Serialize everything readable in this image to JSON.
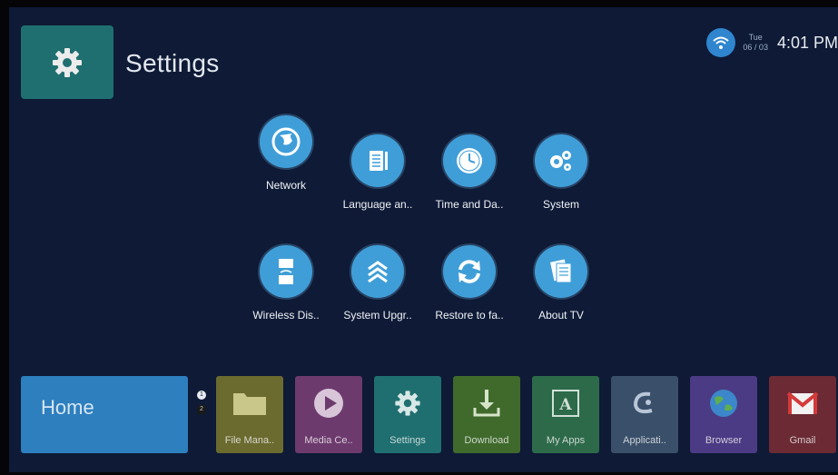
{
  "header": {
    "title": "Settings",
    "app_icon": "gear-icon",
    "status": {
      "wifi_icon": "wifi-icon",
      "day": "Tue",
      "date": "06 / 03",
      "time": "4:01 PM"
    }
  },
  "settings_items": [
    {
      "label": "Network",
      "icon": "network-globe-icon"
    },
    {
      "label": "Language an..",
      "icon": "language-notebook-icon"
    },
    {
      "label": "Time and Da..",
      "icon": "clock-icon"
    },
    {
      "label": "System",
      "icon": "gears-icon"
    },
    {
      "label": "Wireless Dis..",
      "icon": "wireless-display-icon"
    },
    {
      "label": "System Upgr..",
      "icon": "upgrade-chevrons-icon"
    },
    {
      "label": "Restore to fa..",
      "icon": "restore-arrows-icon"
    },
    {
      "label": "About TV",
      "icon": "about-document-icon"
    }
  ],
  "dock": {
    "home_label": "Home",
    "pages": [
      "1",
      "2"
    ],
    "apps": [
      {
        "label": "File Mana..",
        "icon": "folder-icon",
        "color": "#6b6a2f"
      },
      {
        "label": "Media Ce..",
        "icon": "play-icon",
        "color": "#6d3a6e"
      },
      {
        "label": "Settings",
        "icon": "gear-icon",
        "color": "#1f6f70"
      },
      {
        "label": "Download",
        "icon": "download-icon",
        "color": "#3f6a2c"
      },
      {
        "label": "My Apps",
        "icon": "apps-a-icon",
        "color": "#2d6a4a"
      },
      {
        "label": "Applicati..",
        "icon": "application-logo-icon",
        "color": "#3a4f6a"
      },
      {
        "label": "Browser",
        "icon": "globe-icon",
        "color": "#4b3a84"
      },
      {
        "label": "Gmail",
        "icon": "gmail-icon",
        "color": "#6b2a34"
      }
    ]
  }
}
